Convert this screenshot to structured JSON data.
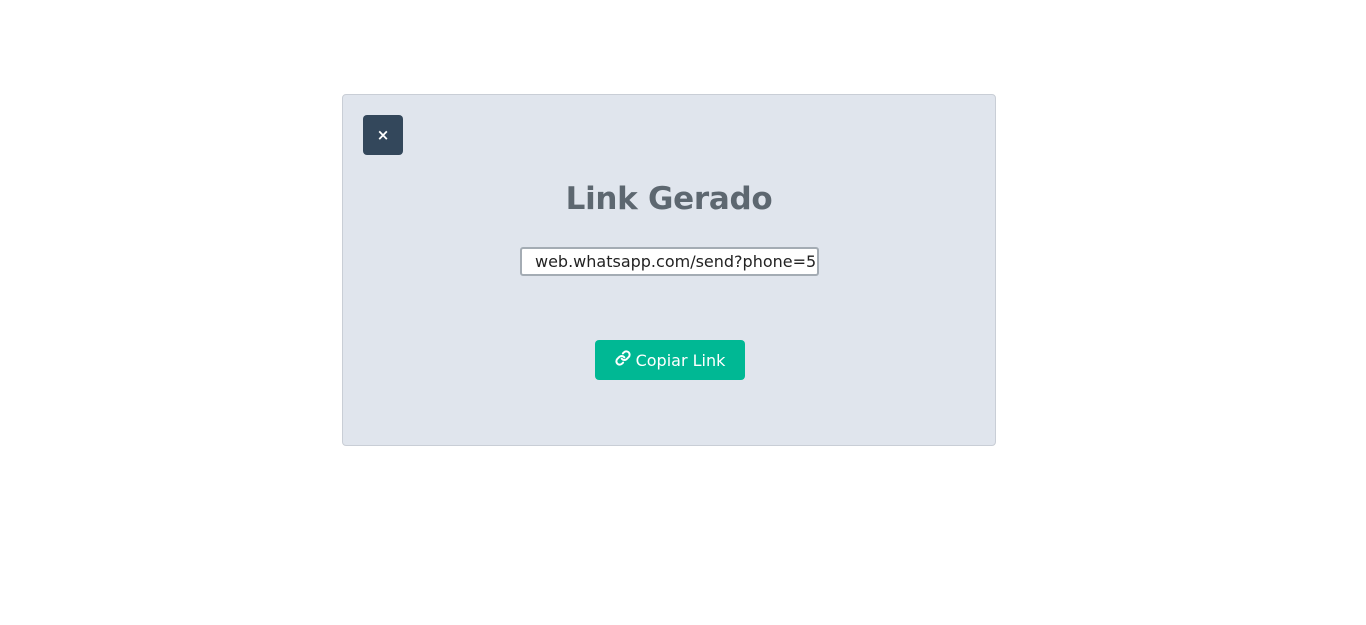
{
  "dialog": {
    "close_label": "×",
    "title": "Link Gerado",
    "link_value": "web.whatsapp.com/send?phone=5",
    "copy_button_label": "Copiar Link",
    "icons": {
      "close": "close-icon",
      "copy": "link-icon"
    }
  },
  "colors": {
    "page_background": "#ffffff",
    "card_background": "#e0e5ed",
    "close_button": "#33475b",
    "title_text": "#5d6770",
    "copy_button": "#00b894"
  }
}
